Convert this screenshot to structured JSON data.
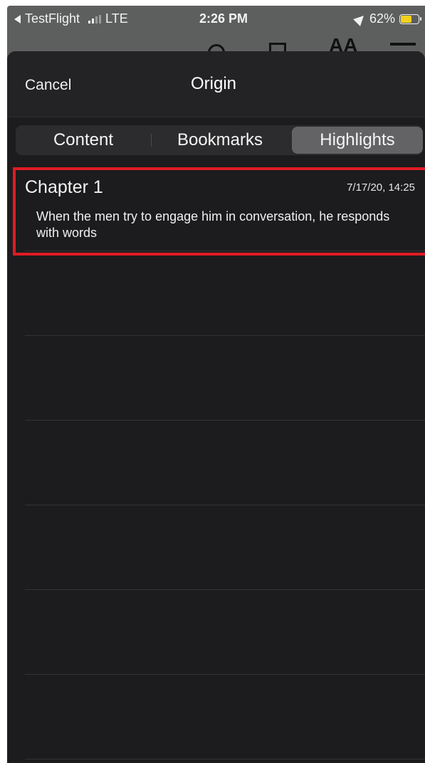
{
  "status_bar": {
    "back_app": "TestFlight",
    "network": "LTE",
    "time": "2:26 PM",
    "battery": "62%",
    "battery_level": 0.62,
    "battery_color": "#f2d21c"
  },
  "sheet": {
    "cancel_label": "Cancel",
    "title": "Origin",
    "tabs": [
      {
        "label": "Content",
        "selected": false
      },
      {
        "label": "Bookmarks",
        "selected": false
      },
      {
        "label": "Highlights",
        "selected": true
      }
    ],
    "highlights": [
      {
        "chapter": "Chapter 1",
        "date": "7/17/20, 14:25",
        "text": "When the men try to engage him in conversation, he responds with words"
      }
    ]
  },
  "colors": {
    "sheet_bg": "#1c1c1e",
    "selected_tab": "#636366",
    "annotation_box": "#e01b24"
  }
}
